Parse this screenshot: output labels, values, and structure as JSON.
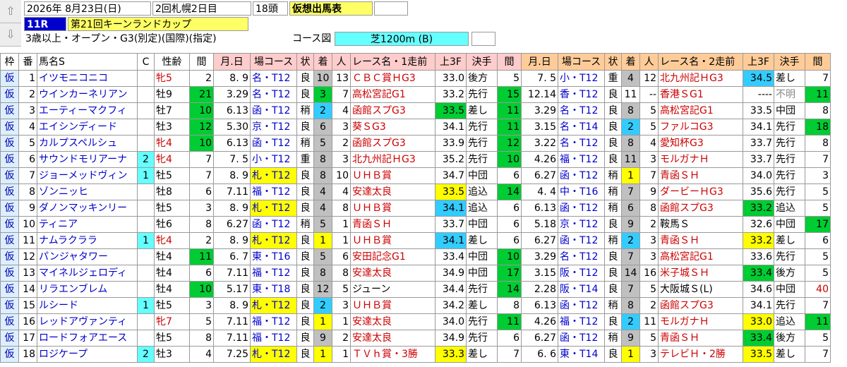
{
  "header": {
    "date": "2026年 8月23日(日)",
    "meeting": "2回札幌2日目",
    "runners": "18頭",
    "mode": "仮想出馬表",
    "race_no": "11R",
    "race_name": "第21回キーンランドカップ",
    "conditions": "3歳以上・オープン・G3(別定)(国際)(指定)",
    "course_label": "コース図",
    "course": "芝1200m (B)"
  },
  "columns": [
    "枠",
    "番",
    "馬名S",
    "C",
    "性齢",
    "間",
    "月.日",
    "場コース",
    "状",
    "着",
    "人",
    "レース名・1走前",
    "上3F",
    "決手",
    "間",
    "月.日",
    "場コース",
    "状",
    "着",
    "人",
    "レース名・2走前",
    "上3F",
    "決手",
    "間"
  ],
  "rows": [
    {
      "w": "仮",
      "n": "1",
      "name": "イツモニコニコ",
      "c": "",
      "sa": "牝5",
      "sx": "red",
      "k": "2",
      "d1": "8. 9",
      "p1": "名・T12",
      "s1": "良",
      "f1": "10",
      "pp1": "13",
      "r1": "ＣＢＣ賞ＨG3",
      "t1": "33.0",
      "t1c": "",
      "m1": "後方",
      "k2": "5",
      "d2": "7. 5",
      "p2": "小・T12",
      "s2": "重",
      "f2": "4",
      "pp2": "12",
      "r2": "北九州記ＨG3",
      "t2": "34.5",
      "t2c": "cyn",
      "m2": "差し",
      "k3": "7",
      "k1c": "",
      "k2c": "",
      "k3c": "",
      "f1c": "gry",
      "f2c": "gry"
    },
    {
      "w": "仮",
      "n": "2",
      "name": "ウインカーネリアン",
      "c": "",
      "sa": "牡9",
      "sx": "",
      "k": "21",
      "d1": "3.29",
      "p1": "名・T12",
      "s1": "良",
      "f1": "3",
      "pp1": "7",
      "r1": "高松宮記G1",
      "t1": "33.2",
      "t1c": "",
      "m1": "先行",
      "k2": "15",
      "d2": "12.14",
      "p2": "香・T12",
      "s2": "良",
      "f2": "11",
      "pp2": "--",
      "r2": "香港ＳG1",
      "t2": "----",
      "t2c": "",
      "m2": "不明",
      "k3": "11",
      "k1c": "grn",
      "k2c": "grn",
      "k3c": "grn",
      "f1c": "grn",
      "f2c": ""
    },
    {
      "w": "仮",
      "n": "3",
      "name": "エーティーマクフィ",
      "c": "",
      "sa": "牡7",
      "sx": "",
      "k": "10",
      "d1": "6.13",
      "p1": "函・T12",
      "s1": "稍",
      "f1": "2",
      "pp1": "4",
      "r1": "函館スプG3",
      "t1": "33.5",
      "t1c": "grn",
      "m1": "差し",
      "k2": "11",
      "d2": "3.29",
      "p2": "名・T12",
      "s2": "良",
      "f2": "8",
      "pp2": "5",
      "r2": "高松宮記G1",
      "t2": "33.5",
      "t2c": "",
      "m2": "中団",
      "k3": "8",
      "k1c": "grn",
      "k2c": "grn",
      "k3c": "",
      "f1c": "cyn",
      "f2c": "gry"
    },
    {
      "w": "仮",
      "n": "4",
      "name": "エイシンディード",
      "c": "",
      "sa": "牡3",
      "sx": "",
      "k": "12",
      "d1": "5.30",
      "p1": "京・T12",
      "s1": "良",
      "f1": "6",
      "pp1": "3",
      "r1": "葵ＳG3",
      "t1": "34.1",
      "t1c": "",
      "m1": "先行",
      "k2": "11",
      "d2": "3.15",
      "p2": "名・T14",
      "s2": "良",
      "f2": "2",
      "pp2": "5",
      "r2": "ファルコG3",
      "t2": "34.1",
      "t2c": "",
      "m2": "先行",
      "k3": "18",
      "k1c": "grn",
      "k2c": "grn",
      "k3c": "grn",
      "f1c": "gry",
      "f2c": "cyn"
    },
    {
      "w": "仮",
      "n": "5",
      "name": "カルプスペルシュ",
      "c": "",
      "sa": "牝4",
      "sx": "red",
      "k": "10",
      "d1": "6.13",
      "p1": "函・T12",
      "s1": "稍",
      "f1": "5",
      "pp1": "2",
      "r1": "函館スプG3",
      "t1": "33.9",
      "t1c": "",
      "m1": "先行",
      "k2": "12",
      "d2": "3.22",
      "p2": "名・T12",
      "s2": "良",
      "f2": "8",
      "pp2": "4",
      "r2": "愛知杯G3",
      "t2": "33.7",
      "t2c": "",
      "m2": "先行",
      "k3": "8",
      "k1c": "grn",
      "k2c": "grn",
      "k3c": "",
      "f1c": "gry",
      "f2c": "gry"
    },
    {
      "w": "仮",
      "n": "6",
      "name": "サウンドモリアーナ",
      "c": "2",
      "sa": "牝4",
      "sx": "red",
      "k": "7",
      "d1": "7. 5",
      "p1": "小・T12",
      "s1": "重",
      "f1": "8",
      "pp1": "3",
      "r1": "北九州記ＨG3",
      "t1": "35.2",
      "t1c": "",
      "m1": "先行",
      "k2": "10",
      "d2": "4.26",
      "p2": "福・T12",
      "s2": "良",
      "f2": "11",
      "pp2": "3",
      "r2": "モルガナＨ",
      "t2": "33.7",
      "t2c": "",
      "m2": "先行",
      "k3": "7",
      "k1c": "",
      "k2c": "grn",
      "k3c": "",
      "f1c": "gry",
      "f2c": "gry"
    },
    {
      "w": "仮",
      "n": "7",
      "name": "ジョーメッドヴィン",
      "c": "1",
      "sa": "牡5",
      "sx": "",
      "k": "7",
      "d1": "8. 9",
      "p1": "札・T12",
      "s1": "良",
      "f1": "8",
      "pp1": "10",
      "r1": "ＵＨＢ賞",
      "t1": "34.7",
      "t1c": "",
      "m1": "中団",
      "k2": "6",
      "d2": "6.27",
      "p2": "函・T12",
      "s2": "稍",
      "f2": "1",
      "pp2": "7",
      "r2": "青函ＳＨ",
      "t2": "34.0",
      "t2c": "",
      "m2": "先行",
      "k3": "3",
      "k1c": "",
      "k2c": "",
      "k3c": "",
      "f1c": "gry",
      "f2c": "ylw"
    },
    {
      "w": "仮",
      "n": "8",
      "name": "ゾンニッヒ",
      "c": "",
      "sa": "牡8",
      "sx": "",
      "k": "6",
      "d1": "7.11",
      "p1": "福・T12",
      "s1": "良",
      "f1": "4",
      "pp1": "4",
      "r1": "安達太良",
      "t1": "33.5",
      "t1c": "ylw",
      "m1": "追込",
      "k2": "14",
      "d2": "4. 4",
      "p2": "中・T16",
      "s2": "稍",
      "f2": "7",
      "pp2": "9",
      "r2": "ダービーＨG3",
      "t2": "35.6",
      "t2c": "",
      "m2": "先行",
      "k3": "5",
      "k1c": "",
      "k2c": "grn",
      "k3c": "",
      "f1c": "gry",
      "f2c": "gry"
    },
    {
      "w": "仮",
      "n": "9",
      "name": "ダノンマッキンリー",
      "c": "",
      "sa": "牡5",
      "sx": "",
      "k": "3",
      "d1": "8. 9",
      "p1": "札・T12",
      "s1": "良",
      "f1": "4",
      "pp1": "8",
      "r1": "ＵＨＢ賞",
      "t1": "34.1",
      "t1c": "cyn",
      "m1": "追込",
      "k2": "6",
      "d2": "6.13",
      "p2": "函・T12",
      "s2": "稍",
      "f2": "6",
      "pp2": "8",
      "r2": "函館スプG3",
      "t2": "33.2",
      "t2c": "grn",
      "m2": "追込",
      "k3": "5",
      "k1c": "",
      "k2c": "",
      "k3c": "",
      "f1c": "gry",
      "f2c": "gry"
    },
    {
      "w": "仮",
      "n": "10",
      "name": "ティニア",
      "c": "",
      "sa": "牡6",
      "sx": "",
      "k": "8",
      "d1": "6.27",
      "p1": "函・T12",
      "s1": "稍",
      "f1": "5",
      "pp1": "1",
      "r1": "青函ＳＨ",
      "t1": "33.7",
      "t1c": "",
      "m1": "中団",
      "k2": "6",
      "d2": "5.18",
      "p2": "京・T12",
      "s2": "良",
      "f2": "9",
      "pp2": "2",
      "r2": "鞍馬Ｓ",
      "t2": "32.6",
      "t2c": "",
      "m2": "中団",
      "k3": "17",
      "k1c": "",
      "k2c": "",
      "k3c": "grn",
      "f1c": "gry",
      "f2c": "gry"
    },
    {
      "w": "仮",
      "n": "11",
      "name": "ナムラクララ",
      "c": "1",
      "sa": "牝4",
      "sx": "red",
      "k": "2",
      "d1": "8. 9",
      "p1": "札・T12",
      "s1": "良",
      "f1": "1",
      "pp1": "1",
      "r1": "ＵＨＢ賞",
      "t1": "34.1",
      "t1c": "cyn",
      "m1": "差し",
      "k2": "6",
      "d2": "6.27",
      "p2": "函・T12",
      "s2": "稍",
      "f2": "2",
      "pp2": "3",
      "r2": "青函ＳＨ",
      "t2": "33.2",
      "t2c": "ylw",
      "m2": "差し",
      "k3": "6",
      "k1c": "",
      "k2c": "",
      "k3c": "",
      "f1c": "ylw",
      "f2c": "cyn"
    },
    {
      "w": "仮",
      "n": "12",
      "name": "パンジャタワー",
      "c": "",
      "sa": "牡4",
      "sx": "",
      "k": "11",
      "d1": "6. 7",
      "p1": "東・T16",
      "s1": "良",
      "f1": "5",
      "pp1": "6",
      "r1": "安田記念G1",
      "t1": "33.4",
      "t1c": "",
      "m1": "中団",
      "k2": "10",
      "d2": "3.29",
      "p2": "名・T12",
      "s2": "良",
      "f2": "7",
      "pp2": "3",
      "r2": "高松宮記G1",
      "t2": "33.6",
      "t2c": "",
      "m2": "先行",
      "k3": "5",
      "k1c": "grn",
      "k2c": "grn",
      "k3c": "",
      "f1c": "gry",
      "f2c": "gry"
    },
    {
      "w": "仮",
      "n": "13",
      "name": "マイネルジェロディ",
      "c": "",
      "sa": "牡4",
      "sx": "",
      "k": "6",
      "d1": "7.11",
      "p1": "福・T12",
      "s1": "良",
      "f1": "8",
      "pp1": "8",
      "r1": "安達太良",
      "t1": "34.9",
      "t1c": "",
      "m1": "中団",
      "k2": "17",
      "d2": "3.15",
      "p2": "阪・T12",
      "s2": "良",
      "f2": "14",
      "pp2": "16",
      "r2": "米子城ＳＨ",
      "t2": "33.4",
      "t2c": "grn",
      "m2": "後方",
      "k3": "5",
      "k1c": "",
      "k2c": "grn",
      "k3c": "",
      "f1c": "gry",
      "f2c": "gry"
    },
    {
      "w": "仮",
      "n": "14",
      "name": "リラエンブレム",
      "c": "",
      "sa": "牡4",
      "sx": "",
      "k": "10",
      "d1": "5.17",
      "p1": "東・T18",
      "s1": "良",
      "f1": "12",
      "pp1": "5",
      "r1": "ジューン",
      "t1": "34.4",
      "t1c": "",
      "m1": "先行",
      "k2": "14",
      "d2": "2.28",
      "p2": "阪・T14",
      "s2": "良",
      "f2": "7",
      "pp2": "5",
      "r2": "大阪城Ｓ(L)",
      "t2": "34.6",
      "t2c": "",
      "m2": "中団",
      "k3": "40",
      "k1c": "grn",
      "k2c": "grn",
      "k3c": "red",
      "f1c": "gry",
      "f2c": "gry"
    },
    {
      "w": "仮",
      "n": "15",
      "name": "ルシード",
      "c": "1",
      "sa": "牡5",
      "sx": "",
      "k": "3",
      "d1": "8. 9",
      "p1": "札・T12",
      "s1": "良",
      "f1": "2",
      "pp1": "3",
      "r1": "ＵＨＢ賞",
      "t1": "34.2",
      "t1c": "",
      "m1": "差し",
      "k2": "8",
      "d2": "6.13",
      "p2": "函・T12",
      "s2": "稍",
      "f2": "8",
      "pp2": "2",
      "r2": "函館スプG3",
      "t2": "34.1",
      "t2c": "",
      "m2": "先行",
      "k3": "7",
      "k1c": "",
      "k2c": "",
      "k3c": "",
      "f1c": "cyn",
      "f2c": "gry"
    },
    {
      "w": "仮",
      "n": "16",
      "name": "レッドアヴァンティ",
      "c": "",
      "sa": "牝7",
      "sx": "red",
      "k": "5",
      "d1": "7.11",
      "p1": "福・T12",
      "s1": "良",
      "f1": "1",
      "pp1": "1",
      "r1": "安達太良",
      "t1": "34.0",
      "t1c": "",
      "m1": "先行",
      "k2": "11",
      "d2": "4.26",
      "p2": "福・T12",
      "s2": "良",
      "f2": "2",
      "pp2": "11",
      "r2": "モルガナＨ",
      "t2": "33.0",
      "t2c": "ylw",
      "m2": "追込",
      "k3": "11",
      "k1c": "",
      "k2c": "grn",
      "k3c": "grn",
      "f1c": "ylw",
      "f2c": "cyn"
    },
    {
      "w": "仮",
      "n": "17",
      "name": "ロードフォアエース",
      "c": "",
      "sa": "牡5",
      "sx": "",
      "k": "8",
      "d1": "7.11",
      "p1": "福・T12",
      "s1": "良",
      "f1": "9",
      "pp1": "2",
      "r1": "安達太良",
      "t1": "34.9",
      "t1c": "",
      "m1": "先行",
      "k2": "6",
      "d2": "6.27",
      "p2": "函・T12",
      "s2": "稍",
      "f2": "9",
      "pp2": "5",
      "r2": "青函ＳＨ",
      "t2": "33.4",
      "t2c": "grn",
      "m2": "後方",
      "k3": "5",
      "k1c": "",
      "k2c": "",
      "k3c": "",
      "f1c": "gry",
      "f2c": "gry"
    },
    {
      "w": "仮",
      "n": "18",
      "name": "ロジケープ",
      "c": "2",
      "sa": "牡3",
      "sx": "",
      "k": "4",
      "d1": "7.25",
      "p1": "札・T12",
      "s1": "良",
      "f1": "1",
      "pp1": "1",
      "r1": "ＴＶｈ賞・3勝",
      "t1": "33.3",
      "t1c": "ylw",
      "m1": "差し",
      "k2": "7",
      "d2": "6. 6",
      "p2": "東・T14",
      "s2": "良",
      "f2": "1",
      "pp2": "3",
      "r2": "テレビＨ・2勝",
      "t2": "33.5",
      "t2c": "ylw",
      "m2": "差し",
      "k3": "7",
      "k1c": "",
      "k2c": "",
      "k3c": "",
      "f1c": "ylw",
      "f2c": "ylw"
    }
  ]
}
